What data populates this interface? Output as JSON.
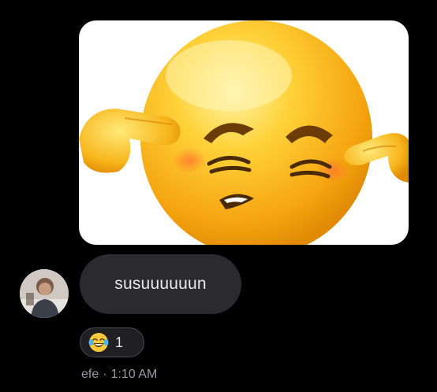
{
  "message_image": {
    "icon": "emoji-covering-ears-image"
  },
  "sender": {
    "avatar_icon": "user-avatar"
  },
  "message": {
    "text": "susuuuuuun",
    "bubble_color": "#2b2b2d"
  },
  "reaction": {
    "emoji_icon": "tears-of-joy-emoji-icon",
    "count": "1"
  },
  "meta": {
    "sender_name": "efe",
    "separator": "·",
    "time": "1:10 AM"
  },
  "colors": {
    "background": "#000000",
    "meta_text": "#9a9aa0"
  }
}
